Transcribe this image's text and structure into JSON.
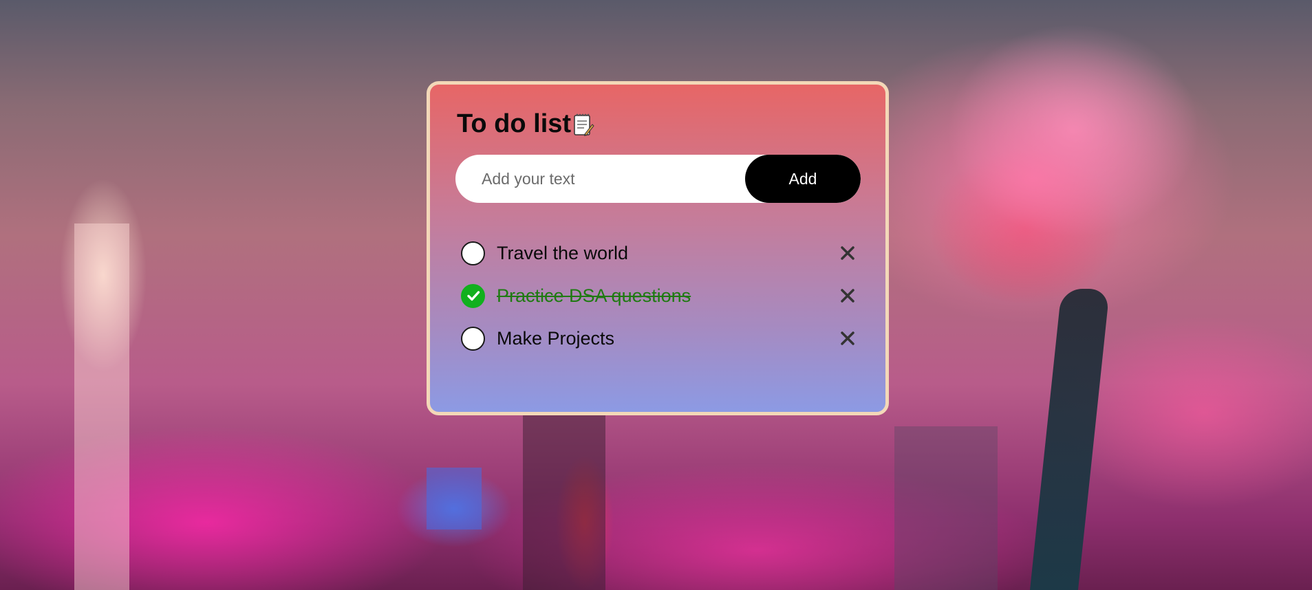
{
  "app": {
    "title": "To do list",
    "title_icon": "notepad-icon"
  },
  "input": {
    "value": "",
    "placeholder": "Add your text"
  },
  "add_button": {
    "label": "Add"
  },
  "tasks": [
    {
      "text": "Travel the world",
      "checked": false
    },
    {
      "text": "Practice DSA questions",
      "checked": true
    },
    {
      "text": "Make Projects",
      "checked": false
    }
  ],
  "colors": {
    "card_gradient_top": "#e76666",
    "card_gradient_bottom": "#8c9ae4",
    "card_border": "#f3d8b8",
    "checked_green": "#11b01e",
    "button_black": "#000000"
  },
  "icons": {
    "checked": "check-circle-icon",
    "unchecked": "empty-circle-icon",
    "delete": "close-icon"
  }
}
